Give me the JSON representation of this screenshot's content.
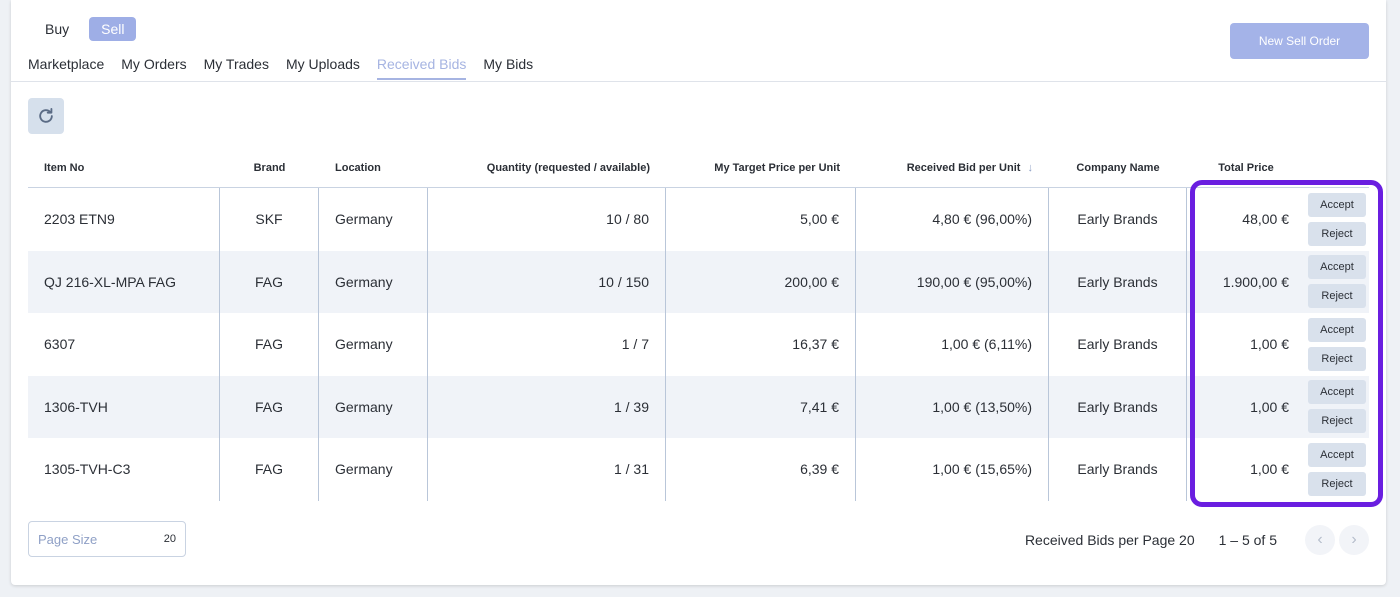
{
  "mode_toggle": {
    "buy": "Buy",
    "sell": "Sell"
  },
  "tabs": [
    "Marketplace",
    "My Orders",
    "My Trades",
    "My Uploads",
    "Received Bids",
    "My Bids"
  ],
  "new_order_label": "New Sell Order",
  "columns": {
    "item_no": "Item No",
    "brand": "Brand",
    "location": "Location",
    "quantity": "Quantity (requested / available)",
    "target_price": "My Target Price per Unit",
    "received_bid": "Received Bid per Unit",
    "company": "Company Name",
    "total_price": "Total Price"
  },
  "sort_icon": "arrow-down-icon",
  "rows": [
    {
      "item_no": "2203 ETN9",
      "brand": "SKF",
      "location": "Germany",
      "quantity": "10 / 80",
      "target_price": "5,00 €",
      "received_bid": "4,80 € (96,00%)",
      "company": "Early Brands",
      "total_price": "48,00 €",
      "accept": "Accept",
      "reject": "Reject"
    },
    {
      "item_no": "QJ 216-XL-MPA FAG",
      "brand": "FAG",
      "location": "Germany",
      "quantity": "10 / 150",
      "target_price": "200,00 €",
      "received_bid": "190,00 € (95,00%)",
      "company": "Early Brands",
      "total_price": "1.900,00 €",
      "accept": "Accept",
      "reject": "Reject"
    },
    {
      "item_no": "6307",
      "brand": "FAG",
      "location": "Germany",
      "quantity": "1 / 7",
      "target_price": "16,37 €",
      "received_bid": "1,00 € (6,11%)",
      "company": "Early Brands",
      "total_price": "1,00 €",
      "accept": "Accept",
      "reject": "Reject"
    },
    {
      "item_no": "1306-TVH",
      "brand": "FAG",
      "location": "Germany",
      "quantity": "1 / 39",
      "target_price": "7,41 €",
      "received_bid": "1,00 € (13,50%)",
      "company": "Early Brands",
      "total_price": "1,00 €",
      "accept": "Accept",
      "reject": "Reject"
    },
    {
      "item_no": "1305-TVH-C3",
      "brand": "FAG",
      "location": "Germany",
      "quantity": "1 / 31",
      "target_price": "6,39 €",
      "received_bid": "1,00 € (15,65%)",
      "company": "Early Brands",
      "total_price": "1,00 €",
      "accept": "Accept",
      "reject": "Reject"
    }
  ],
  "page_size": {
    "label": "Page Size",
    "value": "20"
  },
  "pager": {
    "per_page_text": "Received Bids per Page 20",
    "range_text": "1 – 5 of 5"
  },
  "colors": {
    "accent": "#9eaee6",
    "highlight": "#6a1ee0",
    "alt_row": "#f0f3f8"
  }
}
